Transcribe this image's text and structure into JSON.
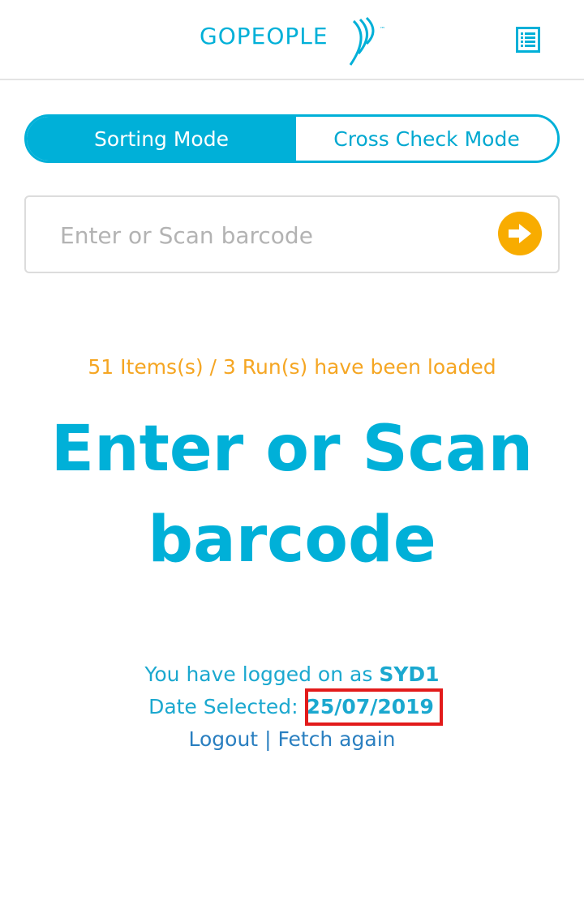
{
  "header": {
    "logo_text": "GOPEOPLE",
    "logo_trademark": "™",
    "menu_icon": "list-menu-icon"
  },
  "mode_toggle": {
    "active_label": "Sorting Mode",
    "inactive_label": "Cross Check Mode"
  },
  "barcode": {
    "placeholder": "Enter or Scan barcode",
    "value": "",
    "submit_icon": "arrow-right-circle-icon"
  },
  "status": {
    "loaded": "51 Items(s) / 3 Run(s) have been loaded"
  },
  "prompt": {
    "line1": "Enter or Scan",
    "line2": "barcode"
  },
  "session": {
    "login_prefix": "You have logged on as ",
    "user": "SYD1",
    "date_prefix": "Date Selected: ",
    "date": "25/07/2019",
    "logout_label": "Logout",
    "separator": "|",
    "fetch_label": "Fetch again"
  },
  "colors": {
    "brand": "#00b0d8",
    "accent": "#f8ac00",
    "status": "#f5a623",
    "highlight": "#e21b1b"
  }
}
